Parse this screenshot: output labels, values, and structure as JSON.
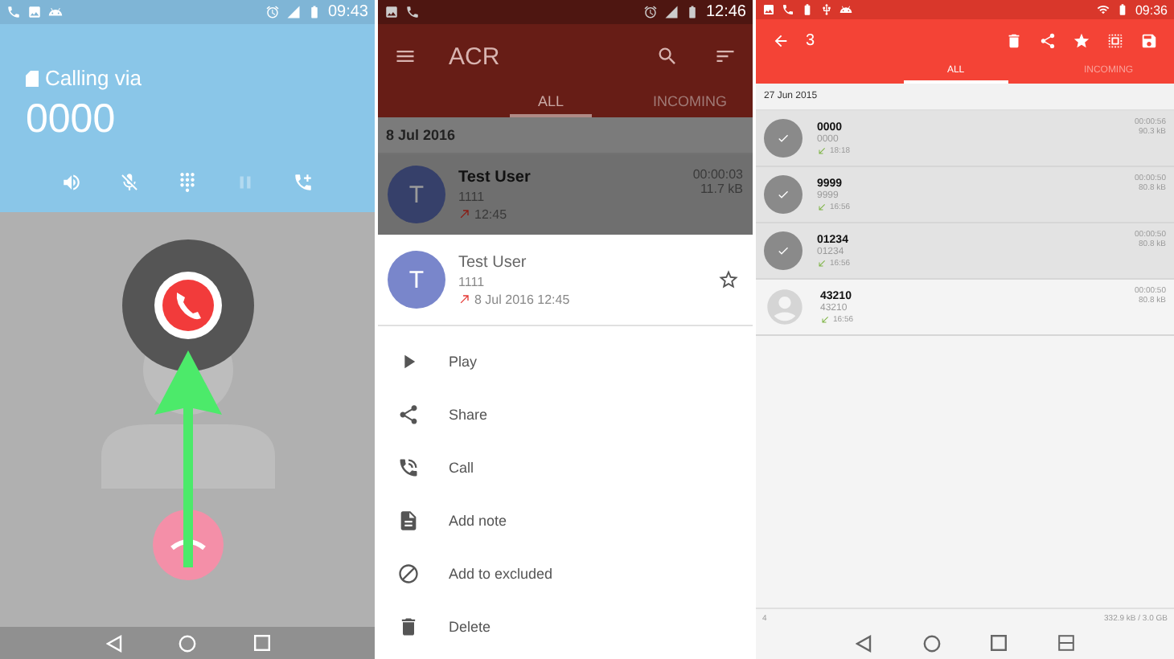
{
  "call_screen": {
    "status_time": "09:43",
    "calling_label": "Calling via",
    "number": "0000",
    "actions": [
      {
        "kind": "speaker",
        "disabled": false
      },
      {
        "kind": "mute",
        "disabled": false
      },
      {
        "kind": "dialpad",
        "disabled": false
      },
      {
        "kind": "hold",
        "disabled": true
      },
      {
        "kind": "add_call",
        "disabled": false
      }
    ]
  },
  "acr_sheet": {
    "status_time": "12:46",
    "app_title": "ACR",
    "tabs": [
      {
        "label": "ALL",
        "selected": true
      },
      {
        "label": "INCOMING",
        "selected": false
      }
    ],
    "date": "8 Jul 2016",
    "recording": {
      "avatar": "T",
      "name": "Test User",
      "number": "1111",
      "time": "12:45",
      "duration": "00:00:03",
      "size": "11.7 kB"
    },
    "sheet": {
      "avatar": "T",
      "name": "Test User",
      "number": "1111",
      "datetime": "8 Jul 2016 12:45",
      "starred": false
    },
    "menu": [
      {
        "kind": "play",
        "label": "Play"
      },
      {
        "kind": "share",
        "label": "Share"
      },
      {
        "kind": "call",
        "label": "Call"
      },
      {
        "kind": "note",
        "label": "Add note"
      },
      {
        "kind": "exclude",
        "label": "Add to excluded"
      },
      {
        "kind": "delete",
        "label": "Delete"
      }
    ]
  },
  "selection": {
    "status_time": "09:36",
    "count": "3",
    "tabs": [
      {
        "label": "ALL",
        "selected": true
      },
      {
        "label": "INCOMING",
        "selected": false
      }
    ],
    "date": "27 Jun 2015",
    "rows": [
      {
        "name": "0000",
        "number": "0000",
        "time": "18:18",
        "duration": "00:00:56",
        "size": "90.3 kB",
        "selected": true
      },
      {
        "name": "9999",
        "number": "9999",
        "time": "16:56",
        "duration": "00:00:50",
        "size": "80.8 kB",
        "selected": true
      },
      {
        "name": "01234",
        "number": "01234",
        "time": "16:56",
        "duration": "00:00:50",
        "size": "80.8 kB",
        "selected": true
      },
      {
        "name": "43210",
        "number": "43210",
        "time": "16:56",
        "duration": "00:00:50",
        "size": "80.8 kB",
        "selected": false
      }
    ],
    "footer": {
      "count": "4",
      "storage": "332.9 kB / 3.0 GB"
    }
  }
}
